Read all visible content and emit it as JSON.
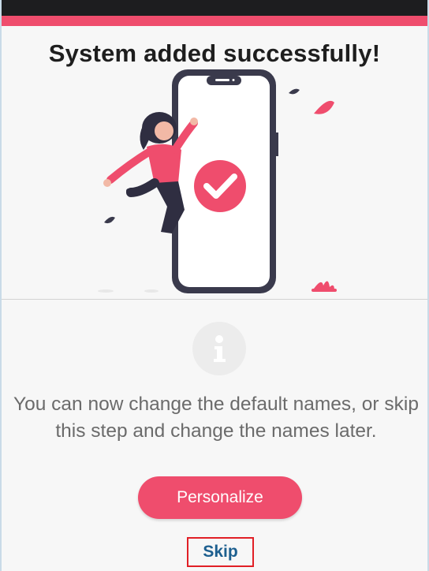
{
  "header": {
    "title": "System added successfully!"
  },
  "illustration": {
    "name": "success-phone-illustration",
    "accent_color": "#ef4d6d",
    "phone_color": "#3a3a4c",
    "icon": "check-circle-icon"
  },
  "info": {
    "icon": "info-icon",
    "message": "You can now change the default names, or skip this step and change the names later."
  },
  "actions": {
    "personalize_label": "Personalize",
    "skip_label": "Skip"
  },
  "colors": {
    "accent": "#ef4d6d",
    "skip_text": "#1d5f8f",
    "status_bar": "#1d1d1f"
  }
}
